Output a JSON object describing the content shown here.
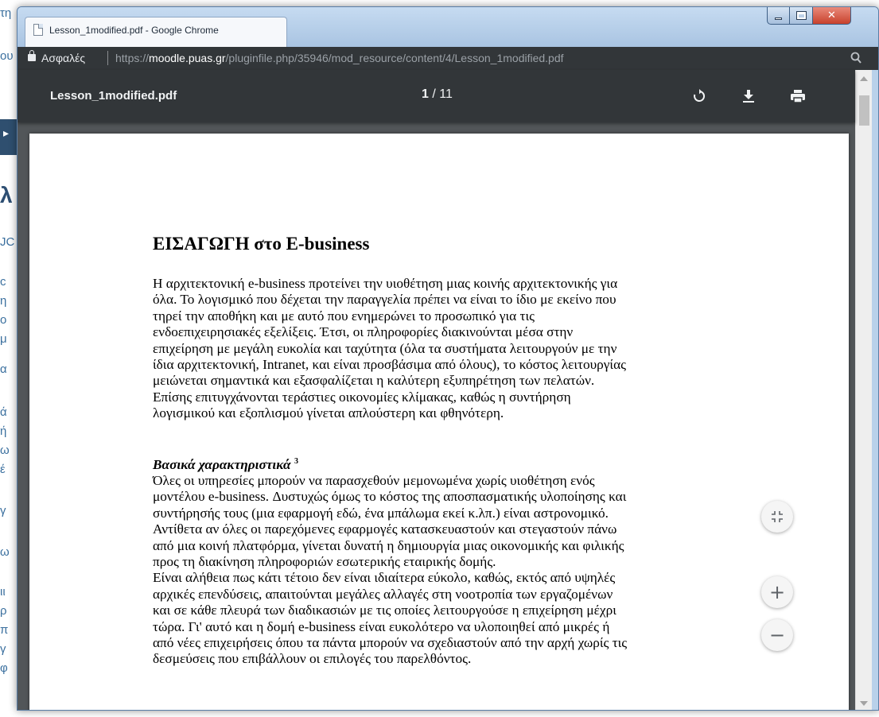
{
  "window": {
    "tab_title": "Lesson_1modified.pdf - Google Chrome",
    "minimize_icon": "minimize-icon",
    "maximize_icon": "maximize-icon",
    "close_icon": "close-icon"
  },
  "address_bar": {
    "secure_label": "Ασφαλές",
    "url_scheme": "https://",
    "url_host": "moodle.puas.gr",
    "url_path": "/pluginfile.php/35946/mod_resource/content/4/Lesson_1modified.pdf",
    "zoom_icon": "magnifier-icon"
  },
  "pdf_toolbar": {
    "filename": "Lesson_1modified.pdf",
    "page_current": "1",
    "page_total": "/ 11",
    "icons": [
      "rotate-icon",
      "download-icon",
      "print-icon"
    ],
    "colors": {
      "toolbar_bg": "#323639",
      "viewer_bg": "#525659"
    }
  },
  "document": {
    "heading": "ΕΙΣΑΓΩΓΗ  στο E-business",
    "para1_lines": [
      "Η αρχιτεκτονική e-business προτείνει την υιοθέτηση μιας κοινής αρχιτεκτονικής για",
      "όλα. Το λογισμικό που δέχεται την παραγγελία πρέπει να είναι το ίδιο με εκείνο που",
      "τηρεί την αποθήκη και με αυτό που ενημερώνει το προσωπικό για τις",
      "ενδοεπιχειρησιακές εξελίξεις. Έτσι, οι πληροφορίες διακινούνται μέσα στην",
      "επιχείρηση με μεγάλη ευκολία και ταχύτητα (όλα τα συστήματα λειτουργούν με την",
      "ίδια αρχιτεκτονική, Intranet, και είναι προσβάσιμα από όλους), το κόστος λειτουργίας",
      "μειώνεται σημαντικά και εξασφαλίζεται η καλύτερη εξυπηρέτηση των πελατών.",
      "Επίσης επιτυγχάνονται τεράστιες οικονομίες κλίμακας, καθώς η συντήρηση",
      "λογισμικού και εξοπλισμού γίνεται απλούστερη και φθηνότερη."
    ],
    "subheading": "Βασικά χαρακτηριστικά",
    "subheading_sup": "3",
    "para2_lines": [
      "Όλες οι υπηρεσίες μπορούν να παρασχεθούν μεμονωμένα χωρίς υιοθέτηση ενός",
      "μοντέλου e-business. Δυστυχώς όμως το κόστος της αποσπασματικής υλοποίησης και",
      "συντήρησής τους (μια εφαρμογή εδώ, ένα μπάλωμα εκεί κ.λπ.) είναι αστρονομικό.",
      "Αντίθετα αν όλες οι παρεχόμενες εφαρμογές κατασκευαστούν και στεγαστούν πάνω",
      "από μια κοινή πλατφόρμα, γίνεται δυνατή η δημιουργία μιας οικονομικής και φιλικής",
      "προς τη διακίνηση πληροφοριών εσωτερικής εταιρικής δομής.",
      "Είναι αλήθεια πως κάτι τέτοιο δεν είναι ιδιαίτερα εύκολο, καθώς, εκτός από υψηλές",
      "αρχικές επενδύσεις, απαιτούνται μεγάλες αλλαγές στη νοοτροπία των εργαζομένων",
      "και σε κάθε πλευρά των διαδικασιών με τις οποίες λειτουργούσε η επιχείρηση μέχρι",
      "τώρα. Γι' αυτό και η δομή e-business είναι ευκολότερο να υλοποιηθεί από μικρές ή",
      "από νέες επιχειρήσεις όπου τα πάντα μπορούν να σχεδιαστούν από την αρχή χωρίς τις",
      "δεσμεύσεις που επιβάλλουν οι επιλογές του παρελθόντος."
    ]
  },
  "viewer_controls": {
    "fit_icon": "fit-to-page-icon",
    "zoom_in_label": "+",
    "zoom_out_label": "−"
  },
  "background_page": {
    "fragments": [
      "τη",
      "ου",
      "λ",
      "JC",
      "c",
      "η",
      "ο",
      "μ",
      "α",
      "ά",
      "ή",
      "ω",
      "έ",
      "γ",
      "ω",
      "ιι",
      "ρ",
      "π",
      "γ",
      "φ"
    ]
  }
}
